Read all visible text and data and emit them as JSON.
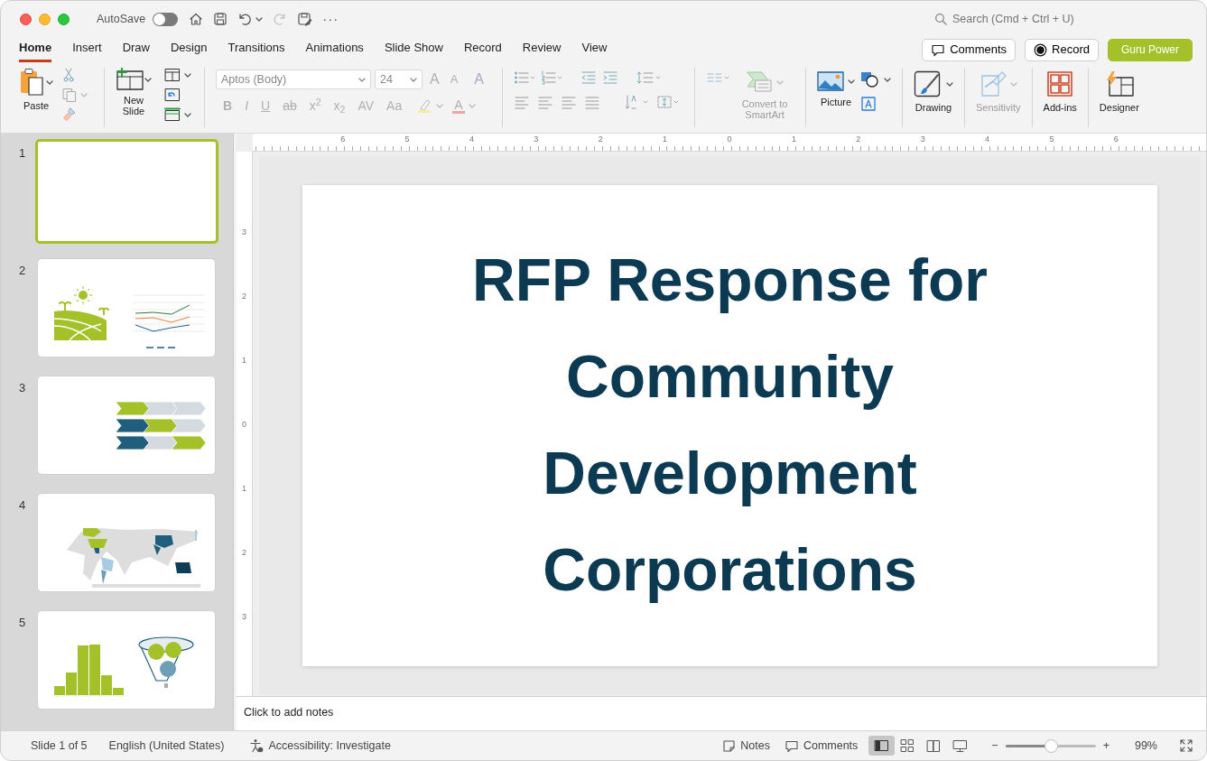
{
  "title_bar": {
    "autosave": {
      "label": "AutoSave",
      "on": false
    },
    "more": "···",
    "search": {
      "placeholder": "Search (Cmd + Ctrl + U)"
    }
  },
  "tabs": [
    {
      "label": "Home",
      "selected": true
    },
    {
      "label": "Insert",
      "selected": false
    },
    {
      "label": "Draw",
      "selected": false
    },
    {
      "label": "Design",
      "selected": false
    },
    {
      "label": "Transitions",
      "selected": false
    },
    {
      "label": "Animations",
      "selected": false
    },
    {
      "label": "Slide Show",
      "selected": false
    },
    {
      "label": "Record",
      "selected": false
    },
    {
      "label": "Review",
      "selected": false
    },
    {
      "label": "View",
      "selected": false
    }
  ],
  "header_buttons": [
    {
      "kind": "comments",
      "label": "Comments"
    },
    {
      "kind": "record",
      "label": "Record"
    },
    {
      "kind": "accent",
      "label": "Guru Power"
    }
  ],
  "ribbon": {
    "paste": "Paste",
    "new_slide": "New Slide",
    "font": {
      "name": "Aptos (Body)",
      "size": "24"
    },
    "font_tools": [
      {
        "kind": "grow",
        "label": "A",
        "disabled": true
      },
      {
        "kind": "shrink",
        "label": "A",
        "disabled": true
      },
      {
        "kind": "clear",
        "label": "A",
        "disabled": true
      }
    ],
    "format": [
      {
        "kind": "plain",
        "label": "B",
        "disabled": true
      },
      {
        "kind": "plain",
        "label": "I",
        "disabled": true
      },
      {
        "kind": "plain",
        "label": "U",
        "disabled": true
      },
      {
        "kind": "plain",
        "label": "ab",
        "disabled": true
      },
      {
        "kind": "plain",
        "label": "x$^{2}$",
        "disabled": true
      },
      {
        "kind": "plain",
        "label": "x$_{2}$",
        "disabled": true
      },
      {
        "kind": "plain",
        "label": "AV",
        "disabled": true
      },
      {
        "kind": "plain",
        "label": "Aa",
        "disabled": true
      },
      {
        "kind": "highlight",
        "disabled": true
      },
      {
        "kind": "color",
        "label": "A",
        "disabled": true
      }
    ],
    "large_buttons": [
      {
        "kind": "smartart",
        "label": "Convert to SmartArt",
        "disabled": true
      },
      {
        "kind": "picture",
        "label": "Picture",
        "disabled": false
      },
      {
        "kind": "drawing",
        "label": "Drawing",
        "disabled": false
      },
      {
        "kind": "sensitivity",
        "label": "Sensitivity",
        "disabled": true
      },
      {
        "kind": "addins",
        "label": "Add-ins",
        "disabled": false
      },
      {
        "kind": "designer",
        "label": "Designer",
        "disabled": false
      }
    ]
  },
  "slides": [
    {
      "number": "1",
      "kind": "blank",
      "selected": true
    },
    {
      "number": "2",
      "kind": "landscape-chart",
      "selected": false
    },
    {
      "number": "3",
      "kind": "chevrons",
      "selected": false
    },
    {
      "number": "4",
      "kind": "map",
      "selected": false
    },
    {
      "number": "5",
      "kind": "histogram-funnel",
      "selected": false
    }
  ],
  "rulers": {
    "horizontal": [
      "6",
      "5",
      "4",
      "3",
      "2",
      "1",
      "0",
      "1",
      "2",
      "3",
      "4",
      "5",
      "6"
    ],
    "vertical": [
      "3",
      "2",
      "1",
      "0",
      "1",
      "2",
      "3"
    ]
  },
  "slide": {
    "title": "RFP Response for Community Development Corporations"
  },
  "notes": {
    "placeholder": "Click to add notes"
  },
  "status_bar": {
    "slide_info": "Slide 1 of 5",
    "language": "English (United States)",
    "accessibility": "Accessibility: Investigate",
    "buttons": [
      {
        "kind": "notes",
        "label": "Notes"
      },
      {
        "kind": "comments",
        "label": "Comments"
      }
    ],
    "views": [
      {
        "kind": "normal",
        "selected": true
      },
      {
        "kind": "sorter",
        "selected": false
      },
      {
        "kind": "reading",
        "selected": false
      },
      {
        "kind": "presenter",
        "selected": false
      }
    ],
    "zoom": {
      "minus": "−",
      "plus": "+",
      "level": 0.5,
      "reading": "99%"
    }
  }
}
